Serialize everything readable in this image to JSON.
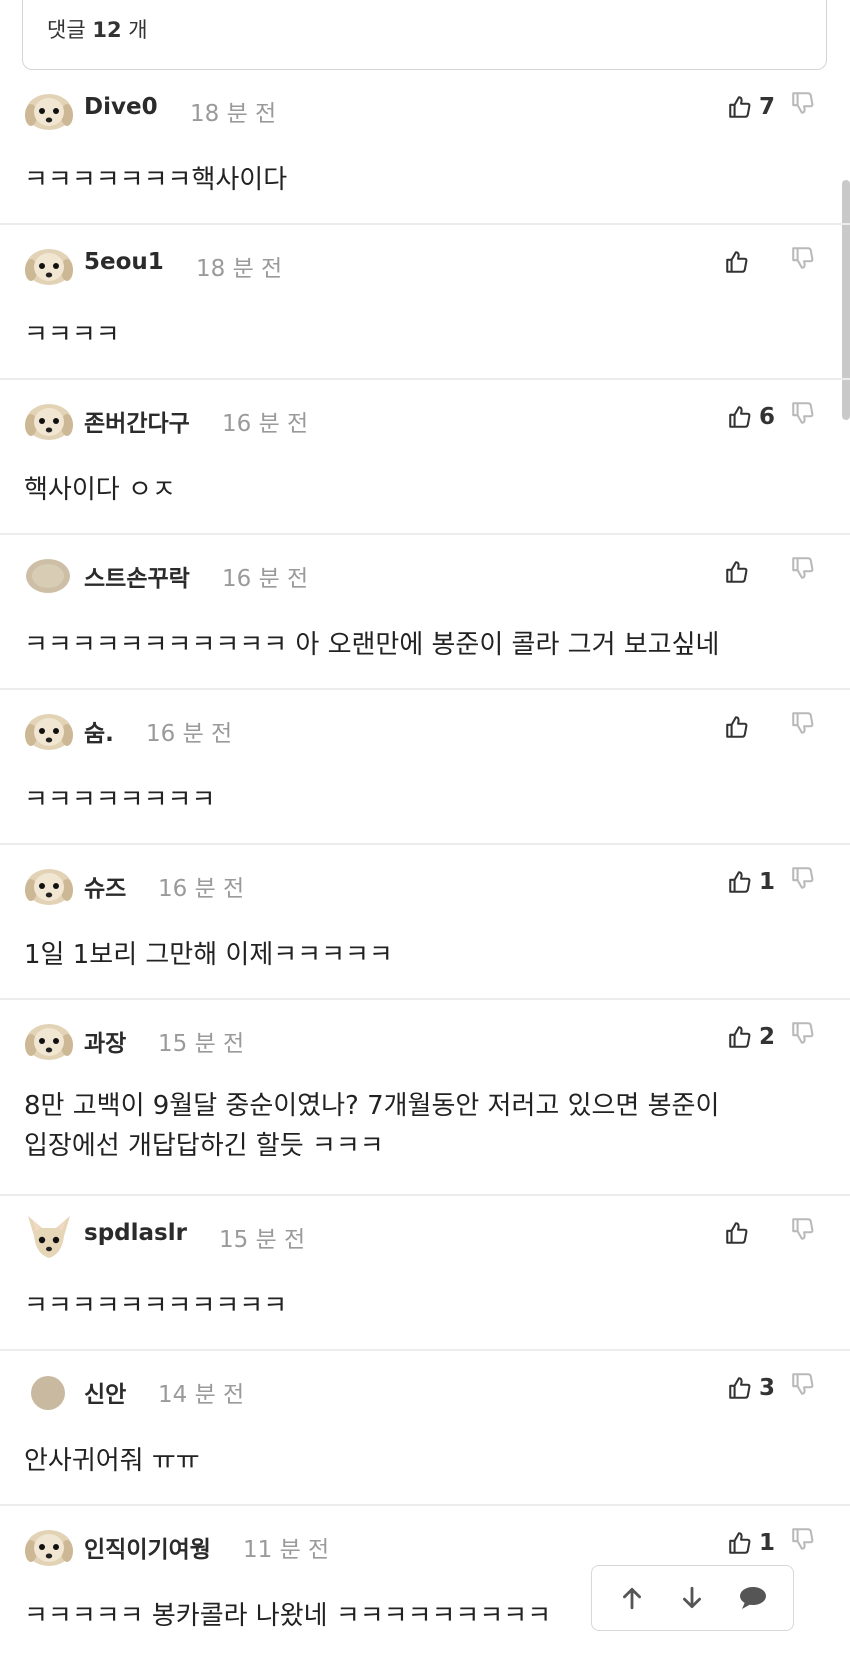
{
  "header": {
    "label": "댓글",
    "count": "12",
    "unit": "개"
  },
  "comments": [
    {
      "name": "Dive0",
      "time": "18 분 전",
      "likes": "7",
      "body": "ㅋㅋㅋㅋㅋㅋㅋ핵사이다",
      "avatar": "maltese-dog",
      "tall": false
    },
    {
      "name": "5eou1",
      "time": "18 분 전",
      "likes": "",
      "body": "ㅋㅋㅋㅋ",
      "avatar": "maltese-dog",
      "tall": false
    },
    {
      "name": "존버간다구",
      "time": "16 분 전",
      "likes": "6",
      "body": "핵사이다 ㅇㅈ",
      "avatar": "maltese-dog",
      "tall": false
    },
    {
      "name": "스트손꾸락",
      "time": "16 분 전",
      "likes": "",
      "body": "ㅋㅋㅋㅋㅋㅋㅋㅋㅋㅋㅋ 아 오랜만에 봉준이 콜라 그거 보고싶네",
      "avatar": "beige-blob",
      "tall": false
    },
    {
      "name": "숨.",
      "time": "16 분 전",
      "likes": "",
      "body": "ㅋㅋㅋㅋㅋㅋㅋㅋ",
      "avatar": "maltese-dog",
      "tall": false
    },
    {
      "name": "슈즈",
      "time": "16 분 전",
      "likes": "1",
      "body": "1일 1보리 그만해 이제ㅋㅋㅋㅋㅋ",
      "avatar": "maltese-dog",
      "tall": false
    },
    {
      "name": "과장",
      "time": "15 분 전",
      "likes": "2",
      "body": "8만 고백이 9월달 중순이였나? 7개월동안 저러고 있으면 봉준이\n입장에선 개답답하긴 할듯 ㅋㅋㅋ",
      "avatar": "maltese-dog",
      "tall": true
    },
    {
      "name": "spdlaslr",
      "time": "15 분 전",
      "likes": "",
      "body": "ㅋㅋㅋㅋㅋㅋㅋㅋㅋㅋㅋ",
      "avatar": "chihuahua",
      "tall": false
    },
    {
      "name": "신안",
      "time": "14 분 전",
      "likes": "3",
      "body": "안사귀어줘 ㅠㅠ",
      "avatar": "beige-circle",
      "tall": false
    },
    {
      "name": "인직이기여웡",
      "time": "11 분 전",
      "likes": "1",
      "body": "ㅋㅋㅋㅋㅋ 봉카콜라 나왔네 ㅋㅋㅋㅋㅋㅋㅋㅋㅋ",
      "avatar": "maltese-dog",
      "tall": false
    }
  ],
  "floater": {
    "icons": [
      "arrow-up-icon",
      "arrow-down-icon",
      "speech-bubble-icon"
    ]
  },
  "colors": {
    "text": "#222222",
    "muted": "#9a9a9a",
    "divider": "#ececec",
    "icon": "#444444"
  }
}
